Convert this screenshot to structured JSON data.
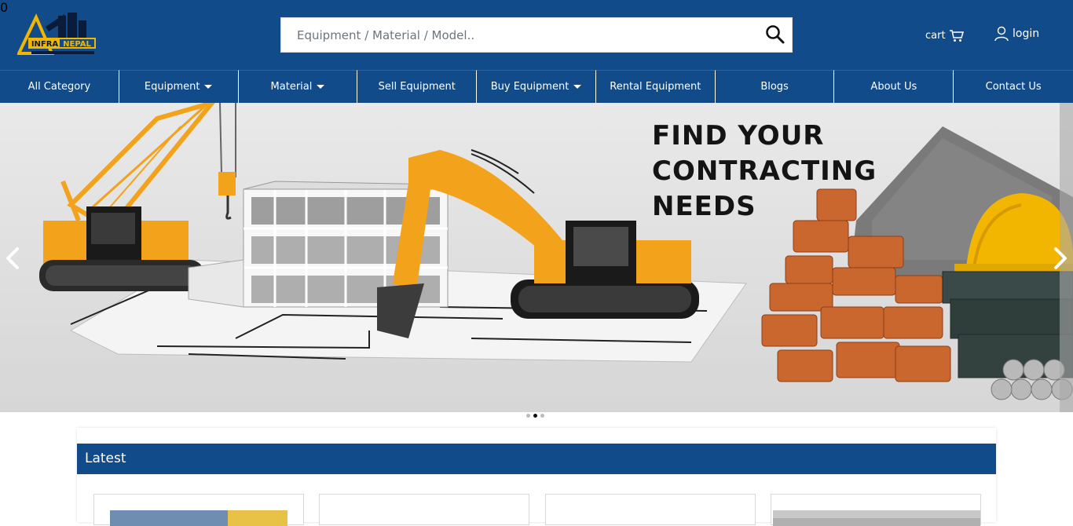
{
  "brand": {
    "name": "INFRA NEPAL",
    "logo_left": "INFRA",
    "logo_right": "NEPAL"
  },
  "search": {
    "placeholder": "Equipment / Material / Model..",
    "icon": "search-icon"
  },
  "header": {
    "cart_label": "cart",
    "cart_count": "0",
    "login_label": "login"
  },
  "nav": {
    "items": [
      {
        "label": "All Category",
        "dropdown": false
      },
      {
        "label": "Equipment",
        "dropdown": true
      },
      {
        "label": "Material",
        "dropdown": true
      },
      {
        "label": "Sell Equipment",
        "dropdown": false
      },
      {
        "label": "Buy Equipment",
        "dropdown": true
      },
      {
        "label": "Rental Equipment",
        "dropdown": false
      },
      {
        "label": "Blogs",
        "dropdown": false
      },
      {
        "label": "About Us",
        "dropdown": false
      },
      {
        "label": "Contact Us",
        "dropdown": false
      }
    ]
  },
  "banner": {
    "headline": [
      "FIND YOUR",
      "CONTRACTING",
      "NEEDS"
    ],
    "slide_count": 3,
    "active_slide": 2
  },
  "latest": {
    "title": "Latest"
  },
  "colors": {
    "brand_blue": "#124b8a",
    "logo_yellow": "#f2b600",
    "excavator_orange": "#f3a21c"
  }
}
